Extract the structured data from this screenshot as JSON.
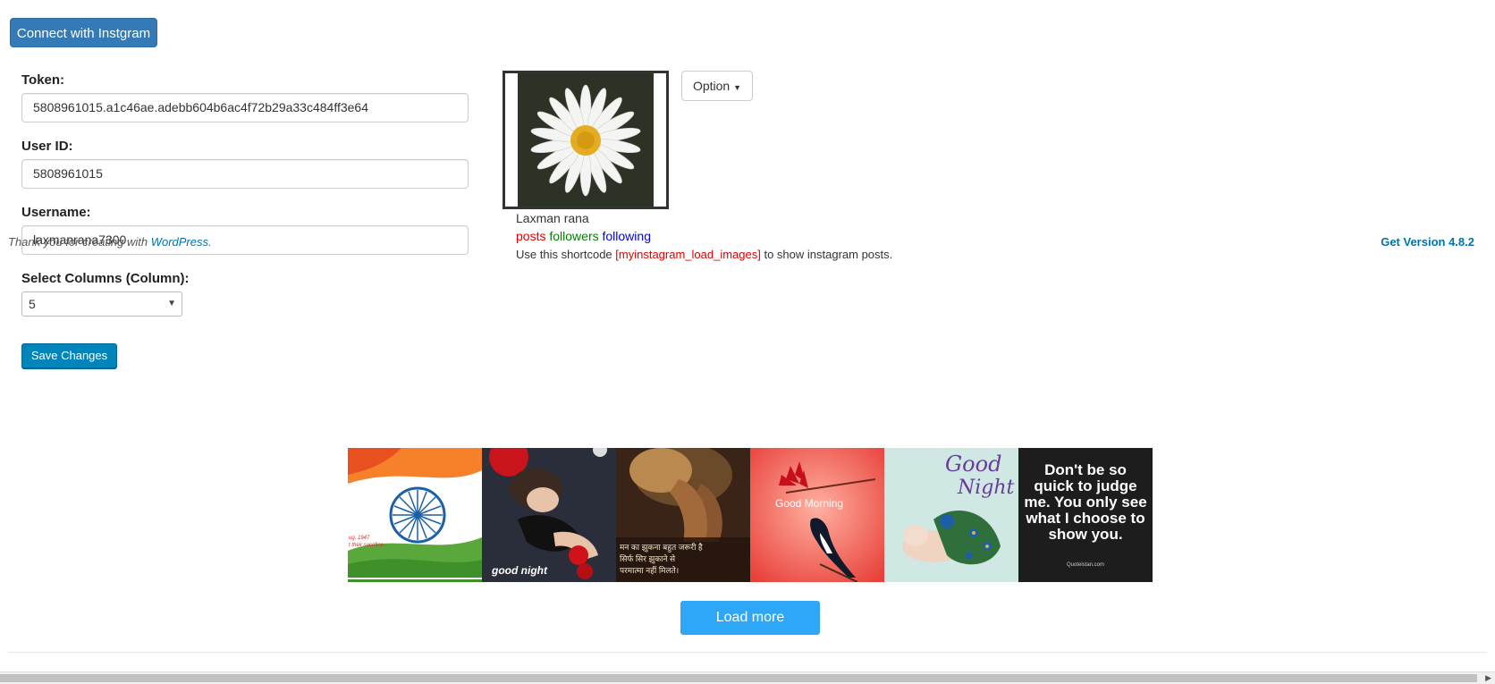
{
  "connect_button": "Connect with Instgram",
  "form": {
    "token_label": "Token:",
    "token_value": "5808961015.a1c46ae.adebb604b6ac4f72b29a33c484ff3e64",
    "userid_label": "User ID:",
    "userid_value": "5808961015",
    "username_label": "Username:",
    "username_value": "laxmanrana7300",
    "columns_label": "Select Columns (Column):",
    "columns_value": "5",
    "save_label": "Save Changes"
  },
  "footer": {
    "thanks_text": "Thank you for creating with ",
    "wordpress_link": "WordPress.",
    "version_link": "Get Version 4.8.2"
  },
  "profile": {
    "option_label": "Option",
    "name": "Laxman rana",
    "posts": "posts",
    "followers": "followers",
    "following": "following",
    "shortcode_prefix": "Use this shortcode ",
    "shortcode": "[myinstagram_load_images]",
    "shortcode_suffix": " to show instagram posts."
  },
  "gallery": {
    "tile1_caption": "ug, 1947",
    "tile1_caption2": "t their sacrifice..",
    "tile2_caption": "good night",
    "tile3_caption": "मन का झुकना बहुत जरूरी है",
    "tile3_caption2": "सिर्फ सिर झुकाने से",
    "tile3_caption3": "परमात्मा नहीं मिलते।",
    "tile4_caption": "Good Morning",
    "tile5_caption": "Good",
    "tile5_caption2": "Night",
    "tile6_text": "Don't be so quick to judge me. You only see what I choose to show you.",
    "tile6_source": "Quoteistan.com",
    "load_more": "Load more"
  },
  "colors": {
    "primary": "#337ab7",
    "wp_blue": "#0085ba",
    "load_more": "#2ea8f6",
    "posts": "#e00000",
    "followers": "#008000",
    "following": "#0000ee"
  }
}
